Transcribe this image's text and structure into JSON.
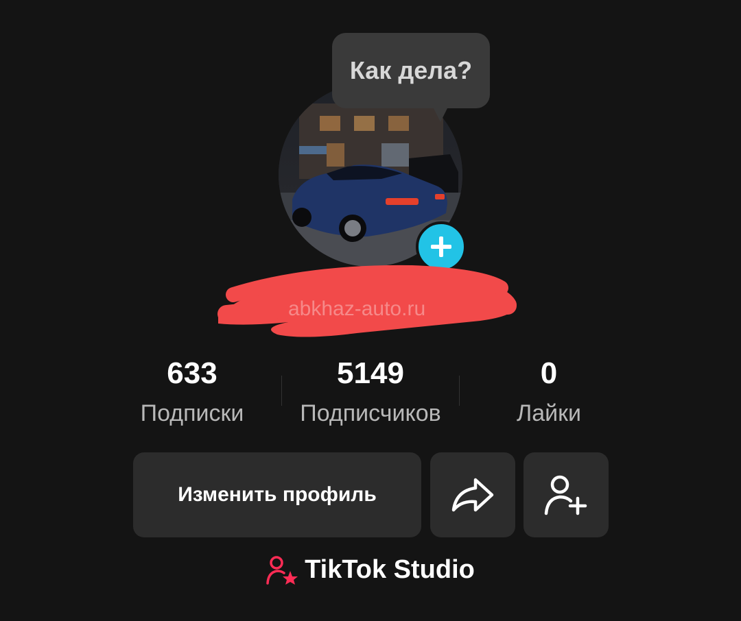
{
  "bubble": {
    "text": "Как дела?"
  },
  "watermark": "abkhaz-auto.ru",
  "stats": [
    {
      "value": "633",
      "label": "Подписки"
    },
    {
      "value": "5149",
      "label": "Подписчиков"
    },
    {
      "value": "0",
      "label": "Лайки"
    }
  ],
  "buttons": {
    "edit_profile": "Изменить профиль"
  },
  "studio": {
    "label": "TikTok Studio"
  },
  "colors": {
    "background": "#141414",
    "accent_cyan": "#22c3e6",
    "accent_pink": "#fe2c55",
    "button_bg": "#2c2c2c",
    "redaction": "#f24a4a"
  },
  "icons": {
    "avatar_add": "plus-icon",
    "share": "share-arrow-icon",
    "add_friend": "add-user-icon",
    "studio": "creator-star-icon"
  }
}
